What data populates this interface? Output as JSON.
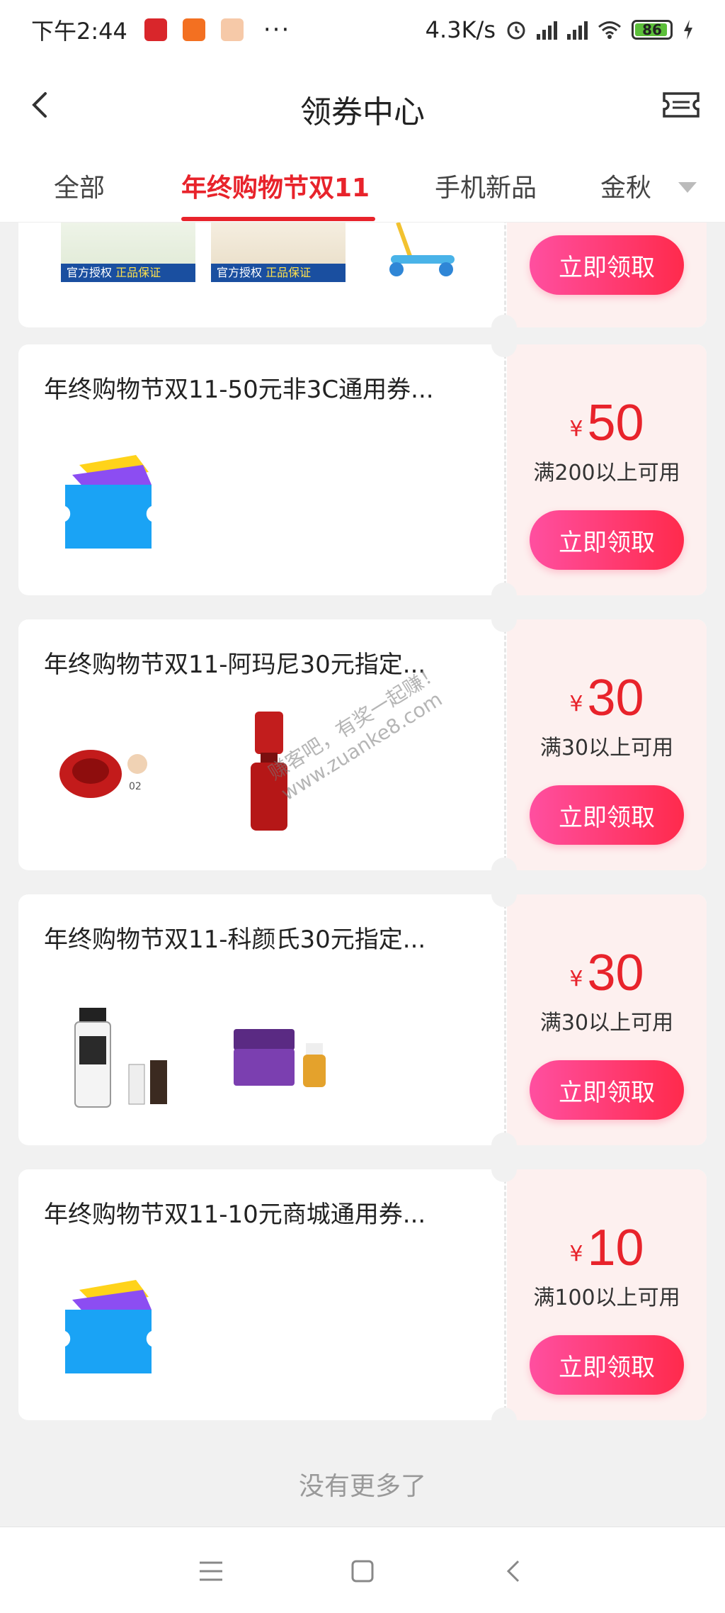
{
  "status_bar": {
    "time": "下午2:44",
    "dots": "···",
    "net_speed": "4.3K/s",
    "battery": "86"
  },
  "header": {
    "title": "领券中心"
  },
  "tabs": [
    {
      "label": "全部",
      "active": false
    },
    {
      "label": "年终购物节双11",
      "active": true
    },
    {
      "label": "手机新品",
      "active": false
    },
    {
      "label": "金秋",
      "active": false
    }
  ],
  "top_card": {
    "badge_text_1": "官方授权",
    "badge_text_2": "正品保证",
    "button_label": "立即领取"
  },
  "coupons": [
    {
      "name": "年终购物节双11-50元非3C通用券...",
      "currency": "¥",
      "amount": "50",
      "condition": "满200以上可用",
      "button_label": "立即领取",
      "image": "coupon-ticket-icon"
    },
    {
      "name": "年终购物节双11-阿玛尼30元指定...",
      "currency": "¥",
      "amount": "30",
      "condition": "满30以上可用",
      "button_label": "立即领取",
      "image": "armani-products"
    },
    {
      "name": "年终购物节双11-科颜氏30元指定...",
      "currency": "¥",
      "amount": "30",
      "condition": "满30以上可用",
      "button_label": "立即领取",
      "image": "kiehls-products"
    },
    {
      "name": "年终购物节双11-10元商城通用券...",
      "currency": "¥",
      "amount": "10",
      "condition": "满100以上可用",
      "button_label": "立即领取",
      "image": "coupon-ticket-icon"
    }
  ],
  "footer_text": "没有更多了",
  "watermark": {
    "line1": "赚客吧，有奖一起赚！",
    "line2": "www.zuanke8.com"
  },
  "colors": {
    "accent": "#e8232b",
    "button_start": "#ff4fa0",
    "button_end": "#ff2a4c",
    "coupon_right_bg": "#fdf0ef"
  }
}
